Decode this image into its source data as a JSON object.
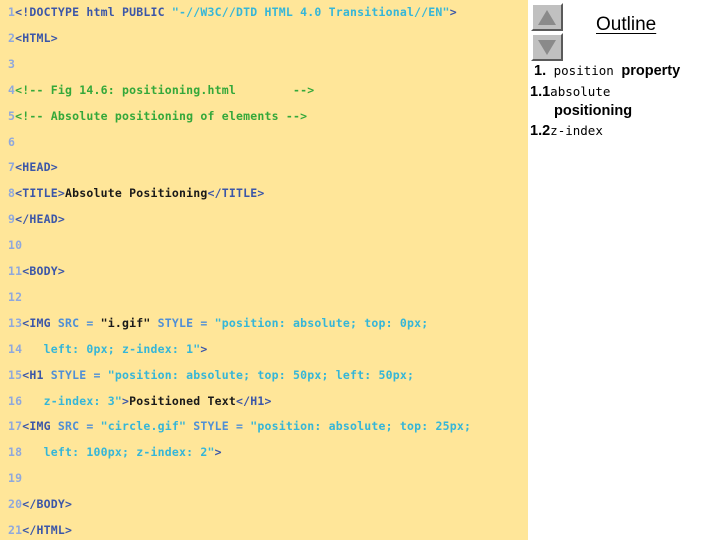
{
  "page": {
    "background_code_panel": "#ffe699",
    "background_outline_panel": "#ffffff"
  },
  "code_listing": {
    "name": "html-source-listing",
    "language": "html",
    "colors": {
      "line_number": "#8fa8dd",
      "tag": "#3b56a8",
      "attribute": "#4f8fd6",
      "value": "#35b6d8",
      "comment": "#34a83a",
      "text": "#1a1a1a"
    },
    "lines": [
      {
        "num": "1",
        "tokens": [
          {
            "t": "tag",
            "s": "<!DOCTYPE html PUBLIC "
          },
          {
            "t": "val",
            "s": "\"-//W3C//DTD HTML 4.0 Transitional//EN\""
          },
          {
            "t": "tag",
            "s": ">"
          }
        ]
      },
      {
        "num": "2",
        "tokens": [
          {
            "t": "tag",
            "s": "<HTML>"
          }
        ]
      },
      {
        "num": "3",
        "tokens": []
      },
      {
        "num": "4",
        "tokens": [
          {
            "t": "cmt",
            "s": "<!-- Fig 14.6: positioning.html        -->"
          }
        ]
      },
      {
        "num": "5",
        "tokens": [
          {
            "t": "cmt",
            "s": "<!-- Absolute positioning of elements -->"
          }
        ]
      },
      {
        "num": "6",
        "tokens": []
      },
      {
        "num": "7",
        "tokens": [
          {
            "t": "tag",
            "s": "<HEAD>"
          }
        ]
      },
      {
        "num": "8",
        "tokens": [
          {
            "t": "tag",
            "s": "<TITLE>"
          },
          {
            "t": "txt",
            "s": "Absolute Positioning"
          },
          {
            "t": "tag",
            "s": "</TITLE>"
          }
        ]
      },
      {
        "num": "9",
        "tokens": [
          {
            "t": "tag",
            "s": "</HEAD>"
          }
        ]
      },
      {
        "num": "10",
        "tokens": []
      },
      {
        "num": "11",
        "tokens": [
          {
            "t": "tag",
            "s": "<BODY>"
          }
        ]
      },
      {
        "num": "12",
        "tokens": []
      },
      {
        "num": "13",
        "tokens": [
          {
            "t": "tag",
            "s": "<IMG "
          },
          {
            "t": "attr",
            "s": "SRC = "
          },
          {
            "t": "txt",
            "s": "\"i.gif\""
          },
          {
            "t": "attr",
            "s": " STYLE = "
          },
          {
            "t": "val",
            "s": "\"position: absolute; top: 0px;"
          }
        ]
      },
      {
        "num": "14",
        "tokens": [
          {
            "t": "val",
            "s": "   left: 0px; z-index: 1\""
          },
          {
            "t": "tag",
            "s": ">"
          }
        ]
      },
      {
        "num": "15",
        "tokens": [
          {
            "t": "tag",
            "s": "<H1 "
          },
          {
            "t": "attr",
            "s": "STYLE = "
          },
          {
            "t": "val",
            "s": "\"position: absolute; top: 50px; left: 50px;"
          }
        ]
      },
      {
        "num": "16",
        "tokens": [
          {
            "t": "val",
            "s": "   z-index: 3\""
          },
          {
            "t": "tag",
            "s": ">"
          },
          {
            "t": "txt",
            "s": "Positioned Text"
          },
          {
            "t": "tag",
            "s": "</H1>"
          }
        ]
      },
      {
        "num": "17",
        "tokens": [
          {
            "t": "tag",
            "s": "<IMG "
          },
          {
            "t": "attr",
            "s": "SRC = "
          },
          {
            "t": "val",
            "s": "\"circle.gif\""
          },
          {
            "t": "attr",
            "s": " STYLE = "
          },
          {
            "t": "val",
            "s": "\"position: absolute; top: 25px;"
          }
        ]
      },
      {
        "num": "18",
        "tokens": [
          {
            "t": "val",
            "s": "   left: 100px; z-index: 2\""
          },
          {
            "t": "tag",
            "s": ">"
          }
        ]
      },
      {
        "num": "19",
        "tokens": []
      },
      {
        "num": "20",
        "tokens": [
          {
            "t": "tag",
            "s": "</BODY>"
          }
        ]
      },
      {
        "num": "21",
        "tokens": [
          {
            "t": "tag",
            "s": "</HTML>"
          }
        ]
      }
    ]
  },
  "outline": {
    "title": "Outline",
    "nav": {
      "up_icon": "triangle-up-icon",
      "down_icon": "triangle-down-icon"
    },
    "items": [
      {
        "number": "1.",
        "parts": [
          {
            "style": "mono",
            "s": " position "
          },
          {
            "style": "sans",
            "s": "property"
          }
        ]
      },
      {
        "number": "1.1",
        "parts": [
          {
            "style": "mono",
            "s": "absolute"
          }
        ],
        "wrap": "positioning"
      },
      {
        "number": "1.2",
        "parts": [
          {
            "style": "mono",
            "s": "z-index"
          }
        ]
      }
    ]
  }
}
